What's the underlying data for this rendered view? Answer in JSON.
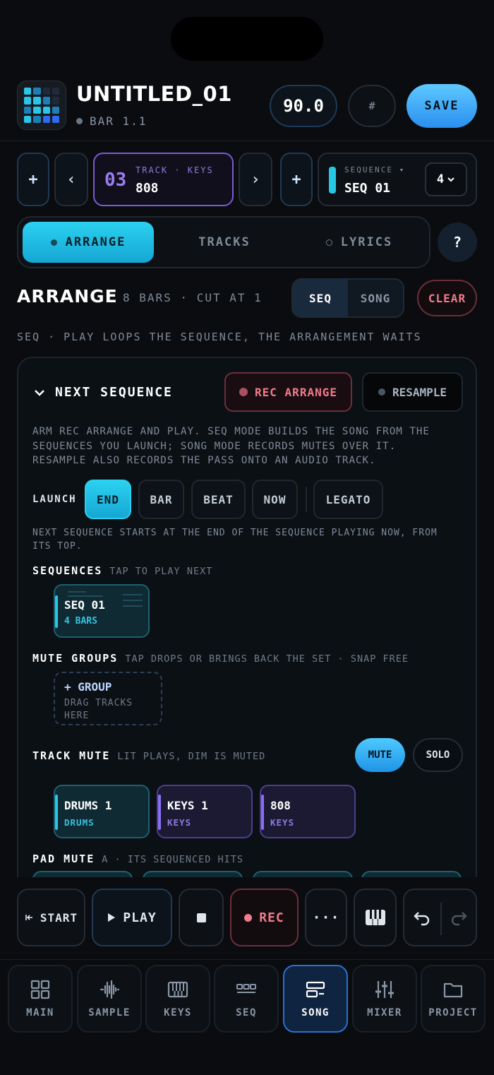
{
  "header": {
    "title": "UNTITLED_01",
    "position": "BAR 1.1",
    "bpm": "90.0",
    "hash_label": "#",
    "save_label": "SAVE"
  },
  "track_row": {
    "add_left": "+",
    "prev": "‹",
    "track_number": "03",
    "track_label": "TRACK · KEYS",
    "track_name": "808",
    "next": "›",
    "add_right": "+",
    "sequence_label": "SEQUENCE ▾",
    "sequence_name": "SEQ 01",
    "sequence_count": "4"
  },
  "tabs": [
    {
      "label": "ARRANGE",
      "active": true
    },
    {
      "label": "TRACKS",
      "active": false
    },
    {
      "label": "LYRICS",
      "active": false
    }
  ],
  "help_label": "?",
  "arrange": {
    "title": "ARRANGE",
    "subtitle": "8 BARS · CUT AT 1",
    "mode_seq": "SEQ",
    "mode_song": "SONG",
    "clear_label": "CLEAR",
    "hint": "SEQ · PLAY LOOPS THE SEQUENCE, THE ARRANGEMENT WAITS"
  },
  "panel": {
    "heading": "NEXT SEQUENCE",
    "rec_arrange": "REC ARRANGE",
    "resample": "RESAMPLE",
    "description": "ARM REC ARRANGE AND PLAY. SEQ MODE BUILDS THE SONG FROM THE SEQUENCES YOU LAUNCH; SONG MODE RECORDS MUTES OVER IT. RESAMPLE ALSO RECORDS THE PASS ONTO AN AUDIO TRACK.",
    "launch_label": "LAUNCH",
    "launch_options": [
      {
        "label": "END",
        "active": true
      },
      {
        "label": "BAR",
        "active": false
      },
      {
        "label": "BEAT",
        "active": false
      },
      {
        "label": "NOW",
        "active": false
      },
      {
        "label": "LEGATO",
        "active": false
      }
    ],
    "launch_description": "NEXT SEQUENCE STARTS AT THE END OF THE SEQUENCE PLAYING NOW, FROM ITS TOP.",
    "sequences_label": "SEQUENCES",
    "sequences_sub": "TAP TO PLAY NEXT",
    "sequence_card": {
      "name": "SEQ 01",
      "bars": "4 BARS"
    },
    "mute_groups_label": "MUTE GROUPS",
    "mute_groups_sub": "TAP DROPS OR BRINGS BACK THE SET · SNAP FREE",
    "group_card": {
      "name": "+ GROUP",
      "desc": "DRAG TRACKS HERE"
    },
    "track_mute_label": "TRACK MUTE",
    "track_mute_sub": "LIT PLAYS, DIM IS MUTED",
    "mute_label": "MUTE",
    "solo_label": "SOLO",
    "tracks": [
      {
        "name": "DRUMS 1",
        "kind": "DRUMS"
      },
      {
        "name": "KEYS 1",
        "kind": "KEYS"
      },
      {
        "name": "808",
        "kind": "KEYS"
      }
    ],
    "pad_mute_label": "PAD MUTE",
    "pad_mute_sub": "A · ITS SEQUENCED HITS"
  },
  "transport": {
    "start": "START",
    "play": "PLAY",
    "rec": "REC",
    "more": "···"
  },
  "nav": [
    {
      "label": "MAIN",
      "icon": "grid-icon"
    },
    {
      "label": "SAMPLE",
      "icon": "waveform-icon"
    },
    {
      "label": "KEYS",
      "icon": "piano-icon"
    },
    {
      "label": "SEQ",
      "icon": "sequencer-icon"
    },
    {
      "label": "SONG",
      "icon": "song-icon",
      "active": true
    },
    {
      "label": "MIXER",
      "icon": "sliders-icon"
    },
    {
      "label": "PROJECT",
      "icon": "folder-icon"
    }
  ],
  "colors": {
    "accent_cyan": "#2bd1f0",
    "accent_blue": "#4ec9ff",
    "accent_purple": "#8a6ff0",
    "record_red": "#f07b8c",
    "background": "#0a0c0f"
  }
}
